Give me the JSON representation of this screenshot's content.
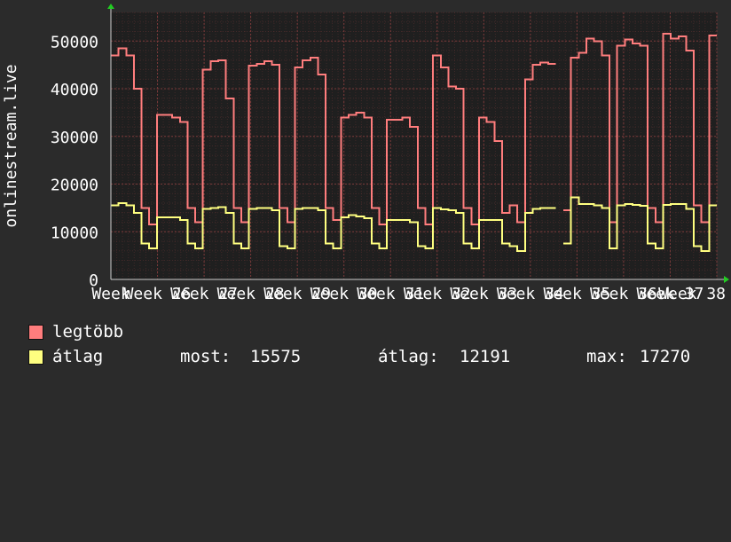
{
  "colors": {
    "background": "#2b2b2b",
    "plot_background": "#1f1f1f",
    "grid": "#5a3030",
    "legtobb": "#ff7d7d",
    "atlag": "#ffff80",
    "axis_arrow": "#22cc22"
  },
  "chart_data": {
    "type": "line",
    "ylabel": "onlinestream.live",
    "ylim": [
      0,
      56000
    ],
    "yticks": [
      0,
      10000,
      20000,
      30000,
      40000,
      50000
    ],
    "xlim": [
      0,
      26
    ],
    "x_tick_positions": [
      0,
      2,
      4,
      6,
      8,
      10,
      12,
      14,
      16,
      18,
      20,
      22,
      24,
      26
    ],
    "x_tick_labels": [
      "Week",
      "Week 26",
      "Week 27",
      "Week 28",
      "Week 29",
      "Week 30",
      "Week 31",
      "Week 32",
      "Week 33",
      "Week 34",
      "Week 35",
      "Week 36",
      "Week 37",
      "Week 38"
    ],
    "grid": true,
    "series": [
      {
        "name": "legtöbb",
        "values": [
          47000,
          48500,
          47000,
          40000,
          15000,
          11500,
          34500,
          34500,
          34000,
          33000,
          15000,
          12000,
          44000,
          45800,
          46000,
          38000,
          15000,
          12000,
          44800,
          45200,
          45800,
          45000,
          15000,
          12000,
          44500,
          46000,
          46500,
          43000,
          15000,
          12500,
          34000,
          34500,
          35000,
          34000,
          15000,
          11500,
          33500,
          33500,
          34000,
          32000,
          15000,
          11500,
          47000,
          44500,
          40500,
          40000,
          15000,
          11500,
          34000,
          33000,
          29000,
          14000,
          15500,
          12000,
          42000,
          45000,
          45500,
          45200,
          null,
          14500,
          46500,
          47500,
          50500,
          50000,
          47000,
          12000,
          49000,
          50300,
          49500,
          49000,
          15000,
          12000,
          51500,
          50500,
          51000,
          48000,
          15500,
          12000,
          51200
        ]
      },
      {
        "name": "átlag",
        "values": [
          15500,
          16000,
          15500,
          14000,
          7500,
          6500,
          13000,
          13000,
          13000,
          12500,
          7500,
          6500,
          14800,
          15000,
          15200,
          14000,
          7500,
          6500,
          14800,
          15000,
          15000,
          14500,
          7000,
          6500,
          14800,
          15000,
          15000,
          14500,
          7500,
          6500,
          13000,
          13500,
          13200,
          12800,
          7500,
          6500,
          12500,
          12500,
          12500,
          12000,
          7000,
          6500,
          15000,
          14700,
          14500,
          14000,
          7500,
          6500,
          12500,
          12500,
          12500,
          7500,
          7000,
          6000,
          14000,
          14800,
          15000,
          15000,
          null,
          7500,
          17200,
          15800,
          15800,
          15500,
          15000,
          6500,
          15500,
          15800,
          15600,
          15400,
          7500,
          6500,
          15600,
          15800,
          15800,
          14800,
          7000,
          6000,
          15500
        ]
      }
    ]
  },
  "legend": {
    "series1_label": "legtöbb",
    "series2_label": "átlag",
    "stats": {
      "now_label": "most:",
      "now_value": "15575",
      "avg_label": "átlag:",
      "avg_value": "12191",
      "max_label": "max:",
      "max_value": "17270"
    }
  }
}
